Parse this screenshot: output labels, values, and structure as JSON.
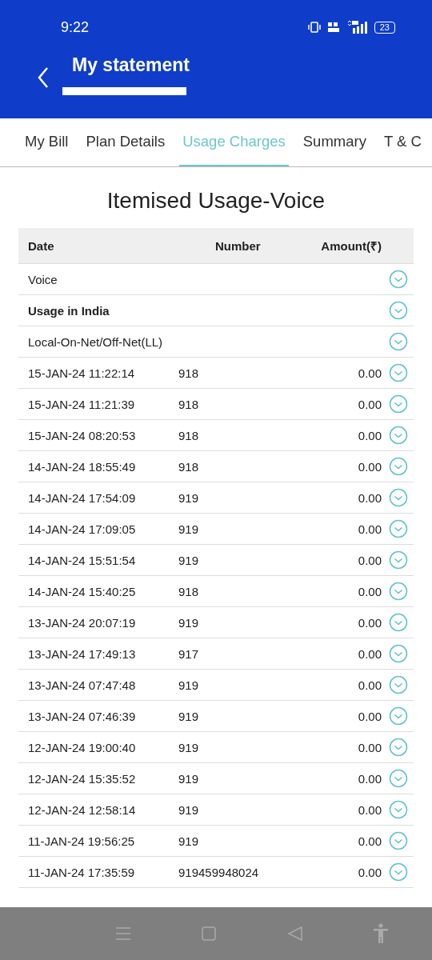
{
  "status_bar": {
    "time": "9:22",
    "battery": "23"
  },
  "header": {
    "title": "My statement"
  },
  "tabs": [
    {
      "label": "My Bill",
      "selected": false
    },
    {
      "label": "Plan Details",
      "selected": false
    },
    {
      "label": "Usage Charges",
      "selected": true
    },
    {
      "label": "Summary",
      "selected": false
    },
    {
      "label": "T & C",
      "selected": false
    }
  ],
  "section_title": "Itemised Usage-Voice",
  "table": {
    "columns": [
      "Date",
      "Number",
      "Amount(₹)"
    ],
    "rows": [
      {
        "kind": "group",
        "label": "Voice"
      },
      {
        "kind": "heading",
        "label": "Usage in India"
      },
      {
        "kind": "group",
        "label": "Local-On-Net/Off-Net(LL)"
      },
      {
        "kind": "call",
        "date": "15-JAN-24 11:22:14",
        "number": "918",
        "amount": "0.00"
      },
      {
        "kind": "call",
        "date": "15-JAN-24 11:21:39",
        "number": "918",
        "amount": "0.00"
      },
      {
        "kind": "call",
        "date": "15-JAN-24 08:20:53",
        "number": "918",
        "amount": "0.00"
      },
      {
        "kind": "call",
        "date": "14-JAN-24 18:55:49",
        "number": "918",
        "amount": "0.00"
      },
      {
        "kind": "call",
        "date": "14-JAN-24 17:54:09",
        "number": "919",
        "amount": "0.00"
      },
      {
        "kind": "call",
        "date": "14-JAN-24 17:09:05",
        "number": "919",
        "amount": "0.00"
      },
      {
        "kind": "call",
        "date": "14-JAN-24 15:51:54",
        "number": "919",
        "amount": "0.00"
      },
      {
        "kind": "call",
        "date": "14-JAN-24 15:40:25",
        "number": "918",
        "amount": "0.00"
      },
      {
        "kind": "call",
        "date": "13-JAN-24 20:07:19",
        "number": "919",
        "amount": "0.00"
      },
      {
        "kind": "call",
        "date": "13-JAN-24 17:49:13",
        "number": "917",
        "amount": "0.00"
      },
      {
        "kind": "call",
        "date": "13-JAN-24 07:47:48",
        "number": "919",
        "amount": "0.00"
      },
      {
        "kind": "call",
        "date": "13-JAN-24 07:46:39",
        "number": "919",
        "amount": "0.00"
      },
      {
        "kind": "call",
        "date": "12-JAN-24 19:00:40",
        "number": "919",
        "amount": "0.00"
      },
      {
        "kind": "call",
        "date": "12-JAN-24 15:35:52",
        "number": "919",
        "amount": "0.00"
      },
      {
        "kind": "call",
        "date": "12-JAN-24 12:58:14",
        "number": "919",
        "amount": "0.00"
      },
      {
        "kind": "call",
        "date": "11-JAN-24 19:56:25",
        "number": "919",
        "amount": "0.00"
      },
      {
        "kind": "call",
        "date": "11-JAN-24 17:35:59",
        "number": "919459948024",
        "amount": "0.00"
      }
    ]
  }
}
